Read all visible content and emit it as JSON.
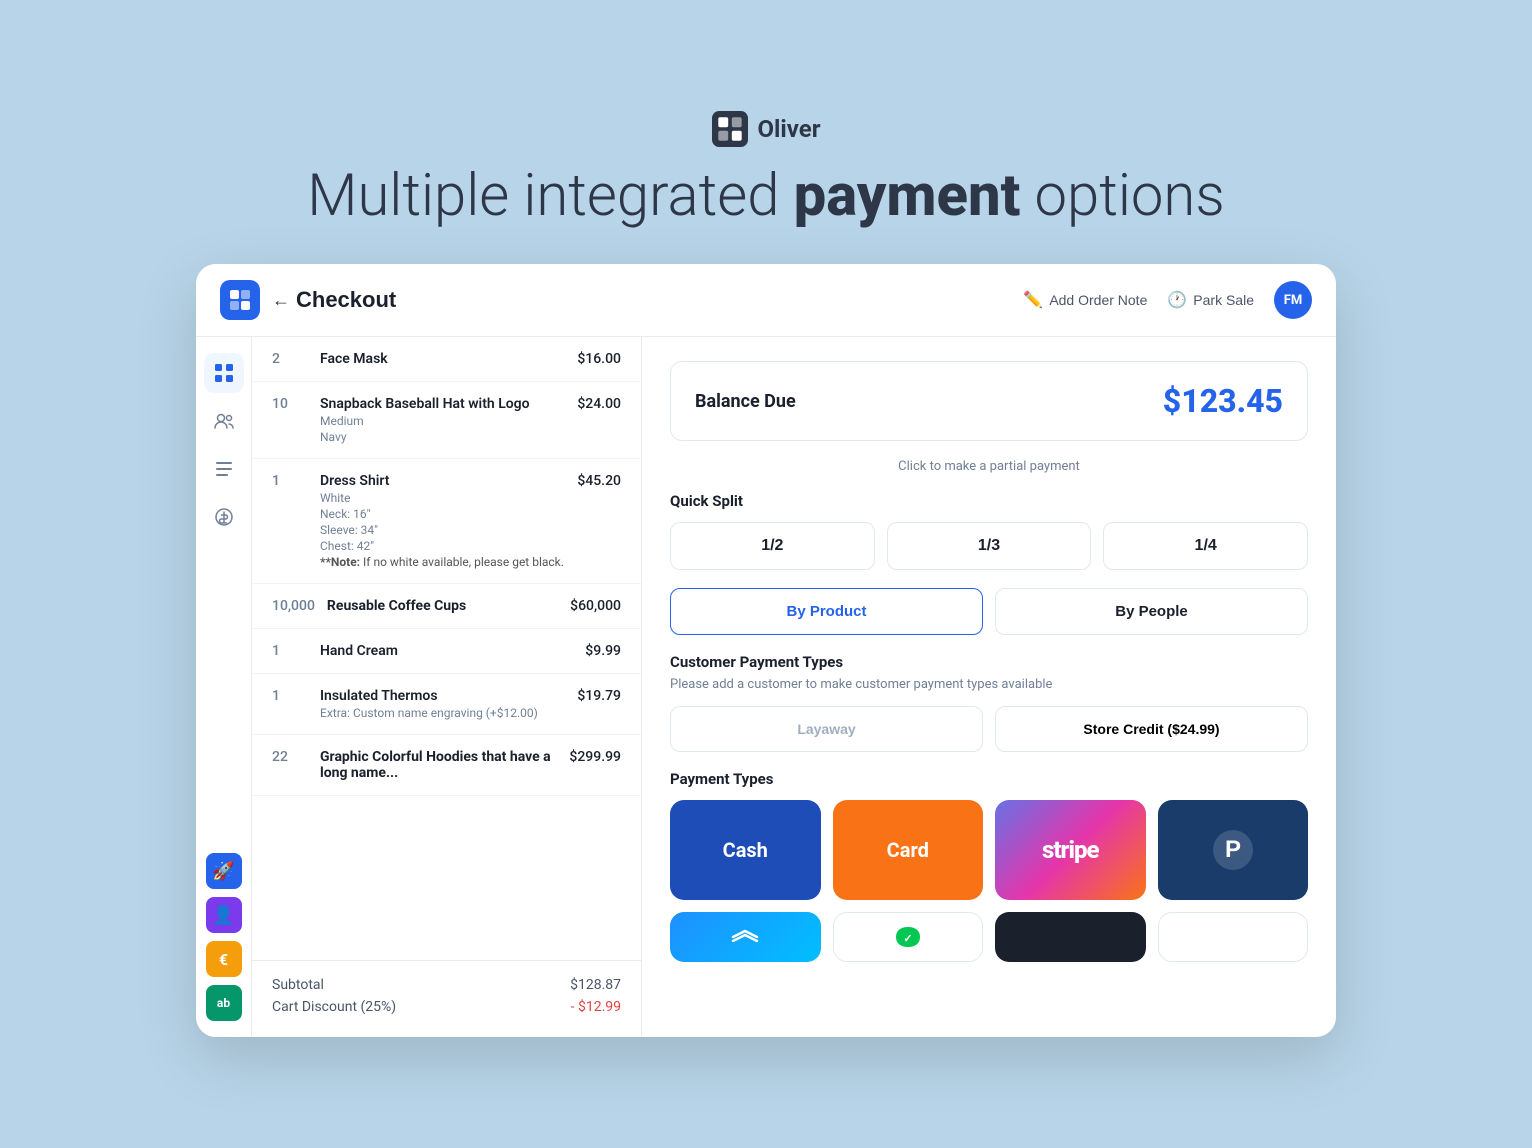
{
  "brand": {
    "name": "Oliver"
  },
  "hero": {
    "title_start": "Multiple integrated ",
    "title_bold": "payment",
    "title_end": " options"
  },
  "topbar": {
    "back_label": "Checkout",
    "add_order_note_label": "Add Order Note",
    "park_sale_label": "Park Sale",
    "avatar_initials": "FM"
  },
  "sidebar": {
    "items": [
      {
        "icon": "grid",
        "active": true
      },
      {
        "icon": "users",
        "active": false
      },
      {
        "icon": "list",
        "active": false
      },
      {
        "icon": "dollar",
        "active": false
      }
    ],
    "apps": [
      {
        "icon": "🚀",
        "color": "blue"
      },
      {
        "icon": "👤",
        "color": "purple"
      },
      {
        "icon": "€",
        "color": "yellow"
      },
      {
        "icon": "ab",
        "color": "green"
      }
    ]
  },
  "order_items": [
    {
      "qty": "2",
      "name": "Face Mask",
      "price": "$16.00",
      "variants": [],
      "note": "",
      "extra": ""
    },
    {
      "qty": "10",
      "name": "Snapback Baseball Hat with Logo",
      "price": "$24.00",
      "variants": [
        "Medium",
        "Navy"
      ],
      "note": "",
      "extra": ""
    },
    {
      "qty": "1",
      "name": "Dress Shirt",
      "price": "$45.20",
      "variants": [
        "White",
        "Neck: 16\"",
        "Sleeve: 34\"",
        "Chest: 42\""
      ],
      "note": "**Note: If no white available, please get black.",
      "extra": ""
    },
    {
      "qty": "10,000",
      "name": "Reusable Coffee Cups",
      "price": "$60,000",
      "variants": [],
      "note": "",
      "extra": ""
    },
    {
      "qty": "1",
      "name": "Hand Cream",
      "price": "$9.99",
      "variants": [],
      "note": "",
      "extra": ""
    },
    {
      "qty": "1",
      "name": "Insulated Thermos",
      "price": "$19.79",
      "variants": [],
      "note": "",
      "extra": "Extra: Custom name engraving (+$12.00)"
    },
    {
      "qty": "22",
      "name": "Graphic Colorful Hoodies that have a long name...",
      "price": "$299.99",
      "variants": [],
      "note": "",
      "extra": ""
    }
  ],
  "order_footer": {
    "subtotal_label": "Subtotal",
    "subtotal_value": "$128.87",
    "discount_label": "Cart Discount (25%)",
    "discount_value": "- $12.99"
  },
  "checkout": {
    "balance_label": "Balance Due",
    "balance_amount": "$123.45",
    "partial_payment_text": "Click to make a partial payment",
    "quick_split_label": "Quick Split",
    "split_buttons": [
      "1/2",
      "1/3",
      "1/4"
    ],
    "split_tab_product": "By Product",
    "split_tab_people": "By People",
    "customer_payment_label": "Customer Payment Types",
    "customer_payment_desc": "Please add a customer to make customer payment types available",
    "layaway_label": "Layaway",
    "store_credit_label": "Store Credit ($24.99)",
    "payment_types_label": "Payment Types",
    "payment_types": [
      {
        "label": "Cash",
        "type": "cash"
      },
      {
        "label": "Card",
        "type": "card"
      },
      {
        "label": "stripe",
        "type": "stripe"
      },
      {
        "label": "PayPal",
        "type": "paypal"
      }
    ]
  }
}
